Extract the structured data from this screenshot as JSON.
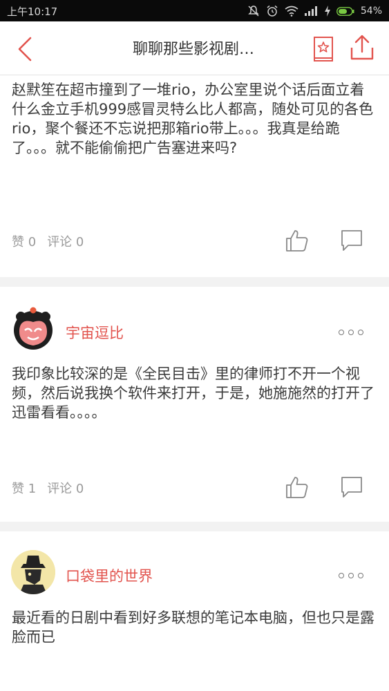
{
  "status_bar": {
    "time": "上午10:17",
    "battery_percent": "54%"
  },
  "nav": {
    "title": "聊聊那些影视剧…",
    "back_icon": "chevron-left-icon",
    "favorite_icon": "star-bookmark-icon",
    "share_icon": "share-upload-icon",
    "accent_color": "#e2534d"
  },
  "posts": [
    {
      "text": "赵默笙在超市撞到了一堆rio，办公室里说个话后面立着什么金立手机999感冒灵特么比人都高，随处可见的各色rio，聚个餐还不忘说把那箱rio带上。。。我真是给跪了。。。就不能偷偷把广告塞进来吗?",
      "likes": "赞 0",
      "comments": "评论 0"
    },
    {
      "username": "宇宙逗比",
      "text": "我印象比较深的是《全民目击》里的律师打不开一个视频，然后说我换个软件来打开，于是，她施施然的打开了迅雷看看。。。。",
      "likes": "赞 1",
      "comments": "评论 0"
    },
    {
      "username": "口袋里的世界",
      "text": "最近看的日剧中看到好多联想的笔记本电脑，但也只是露脸而已"
    }
  ]
}
